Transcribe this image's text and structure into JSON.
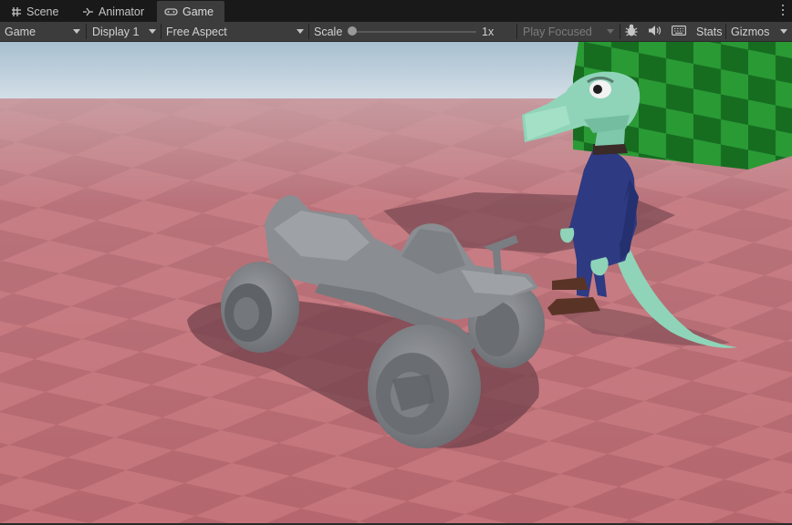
{
  "tabs": [
    {
      "label": "Scene",
      "icon": "grid-icon"
    },
    {
      "label": "Animator",
      "icon": "animator-icon"
    },
    {
      "label": "Game",
      "icon": "gamepad-icon",
      "active": true
    }
  ],
  "toolbar": {
    "game_dropdown": "Game",
    "display_dropdown": "Display 1",
    "aspect_dropdown": "Free Aspect",
    "scale_label": "Scale",
    "scale_value": "1x",
    "play_mode_dropdown": "Play Focused",
    "stats_label": "Stats",
    "gizmos_label": "Gizmos"
  },
  "colors": {
    "panel_bg": "#191919",
    "toolbar_bg": "#3c3c3c",
    "floor_light": "#c5747b",
    "floor_dark": "#b0646c",
    "sky": "#b9cdda",
    "wall_green": "#1f8a2a",
    "character_skin": "#8fd4b8",
    "character_suit": "#2e3a82",
    "vehicle_gray": "#8a8d91"
  },
  "scene": {
    "description_objects": [
      "checkered-floor",
      "green-checker-wall",
      "gray-atv-vehicle",
      "crocodile-character"
    ]
  }
}
